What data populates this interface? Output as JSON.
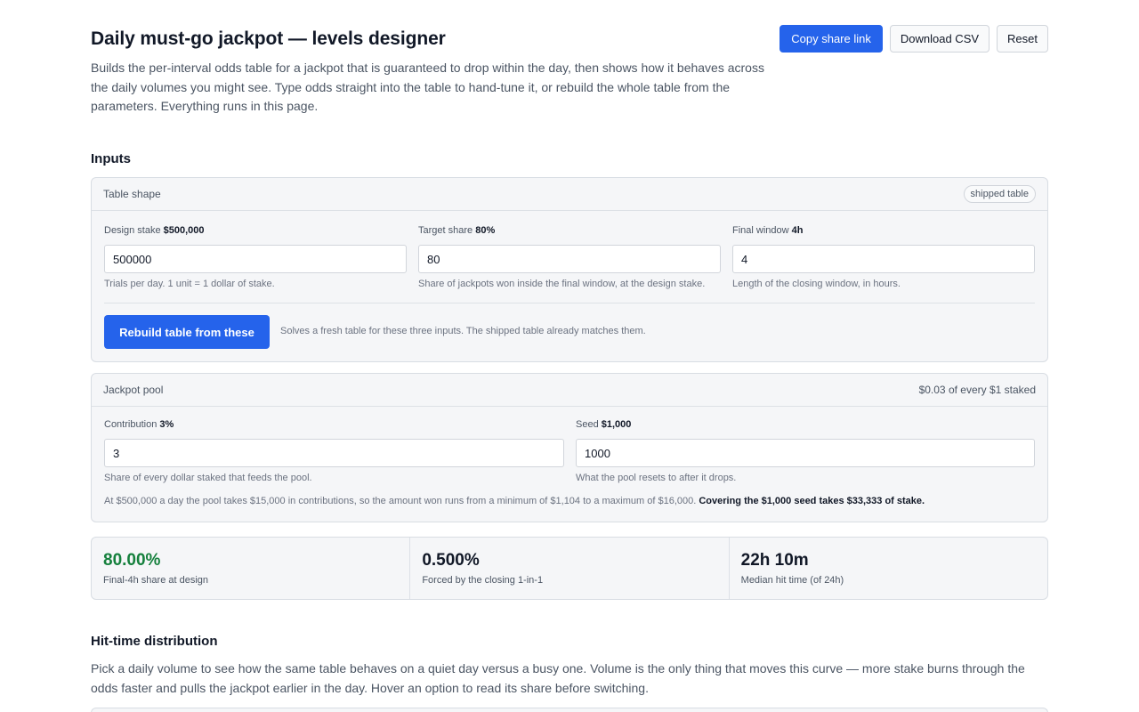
{
  "header": {
    "title": "Daily must-go jackpot — levels designer",
    "description": "Builds the per-interval odds table for a jackpot that is guaranteed to drop within the day, then shows how it behaves across the daily volumes you might see. Type odds straight into the table to hand-tune it, or rebuild the whole table from the parameters. Everything runs in this page.",
    "actions": {
      "copy_link": "Copy share link",
      "download_csv": "Download CSV",
      "reset": "Reset"
    }
  },
  "inputs": {
    "title": "Inputs",
    "table_shape": {
      "title": "Table shape",
      "badge": "shipped table",
      "design_stake": {
        "label": "Design stake",
        "value_label": "$500,000",
        "value": "500000",
        "hint": "Trials per day. 1 unit = 1 dollar of stake."
      },
      "target_share": {
        "label": "Target share",
        "value_label": "80%",
        "value": "80",
        "hint": "Share of jackpots won inside the final window, at the design stake."
      },
      "final_window": {
        "label": "Final window",
        "value_label": "4h",
        "value": "4",
        "hint": "Length of the closing window, in hours."
      },
      "rebuild_label": "Rebuild table from these",
      "rebuild_note": "Solves a fresh table for these three inputs. The shipped table already matches them."
    },
    "jackpot_pool": {
      "title": "Jackpot pool",
      "rate_note": "$0.03 of every $1 staked",
      "contribution": {
        "label": "Contribution",
        "value_label": "3%",
        "value": "3",
        "hint": "Share of every dollar staked that feeds the pool."
      },
      "seed": {
        "label": "Seed",
        "value_label": "$1,000",
        "value": "1000",
        "hint": "What the pool resets to after it drops."
      },
      "summary": "At $500,000 a day the pool takes $15,000 in contributions, so the amount won runs from a minimum of $1,104 to a maximum of $16,000.",
      "summary_bold": "Covering the $1,000 seed takes $33,333 of stake."
    }
  },
  "stats": [
    {
      "value": "80.00%",
      "label": "Final-4h share at design"
    },
    {
      "value": "0.500%",
      "label": "Forced by the closing 1-in-1"
    },
    {
      "value": "22h 10m",
      "label": "Median hit time (of 24h)"
    }
  ],
  "distribution": {
    "title": "Hit-time distribution",
    "description": "Pick a daily volume to see how the same table behaves on a quiet day versus a busy one. Volume is the only thing that moves this curve — more stake burns through the odds faster and pulls the jackpot earlier in the day. Hover an option to read its share before switching."
  },
  "colors": {
    "accent": "#2563eb",
    "success": "#15803d"
  }
}
